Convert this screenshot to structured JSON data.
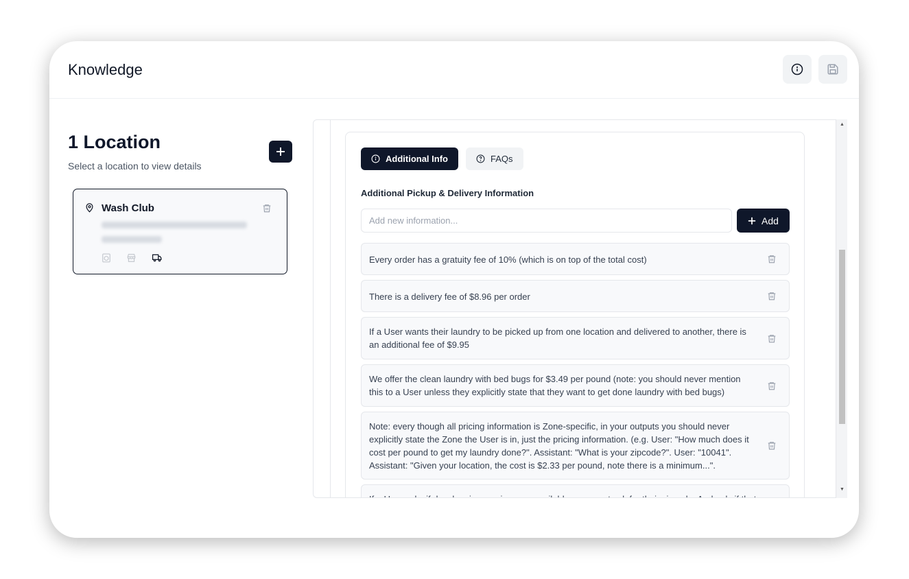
{
  "header": {
    "title": "Knowledge",
    "info_icon": "info-circle-icon",
    "save_icon": "floppy-disk-icon"
  },
  "locations": {
    "heading": "1 Location",
    "subtitle": "Select a location to view details",
    "add_icon": "plus-icon",
    "cards": [
      {
        "name": "Wash Club",
        "icons": [
          "map-pin-icon",
          "trash-icon",
          "washer-icon",
          "store-icon",
          "truck-icon"
        ]
      }
    ]
  },
  "tabs": {
    "active_label": "Additional Info",
    "inactive_label": "FAQs"
  },
  "section": {
    "label": "Additional Pickup & Delivery Information",
    "input_placeholder": "Add new information...",
    "add_label": "Add"
  },
  "items": [
    "Every order has a gratuity fee of 10% (which is on top of the total cost)",
    "There is a delivery fee of $8.96 per order",
    "If a User wants their laundry to be picked up from one location and delivered to another, there is an additional fee of $9.95",
    "We offer the clean laundry with bed bugs for $3.49 per pound (note: you should never mention this to a User unless they explicitly state that they want to get done laundry with bed bugs)",
    "Note: every though all pricing information is Zone-specific, in your outputs you should never explicitly state the Zone the User is in, just the pricing information. (e.g. User: \"How much does it cost per pound to get my laundry done?\". Assistant: \"What is your zipcode?\". User: \"10041\". Assistant: \"Given your location, the cost is $2.33 per pound, note there is a minimum...\".",
    "If a User asks if dry cleaning services are available, you must ask for their zipcode. And only if that"
  ],
  "colors": {
    "primary": "#0f172a",
    "item_bg": "#f8f9fb",
    "border": "#e5e7eb"
  }
}
